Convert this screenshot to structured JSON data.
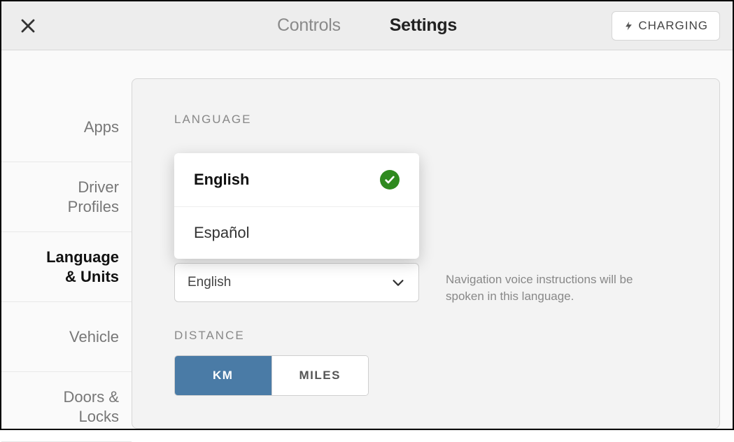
{
  "header": {
    "tabs": {
      "controls": "Controls",
      "settings": "Settings"
    },
    "charging_label": "CHARGING"
  },
  "sidebar": {
    "items": [
      {
        "label": "Apps"
      },
      {
        "label": "Driver Profiles"
      },
      {
        "label": "Language & Units"
      },
      {
        "label": "Vehicle"
      },
      {
        "label": "Doors & Locks"
      }
    ]
  },
  "language_section": {
    "label": "LANGUAGE",
    "dropdown": {
      "options": [
        {
          "label": "English",
          "selected": true
        },
        {
          "label": "Español",
          "selected": false
        }
      ]
    },
    "nav_voice_select": {
      "value": "English"
    },
    "nav_help_text": "Navigation voice instructions will be spoken in this language."
  },
  "distance_section": {
    "label": "DISTANCE",
    "options": {
      "km": "KM",
      "miles": "MILES"
    }
  }
}
